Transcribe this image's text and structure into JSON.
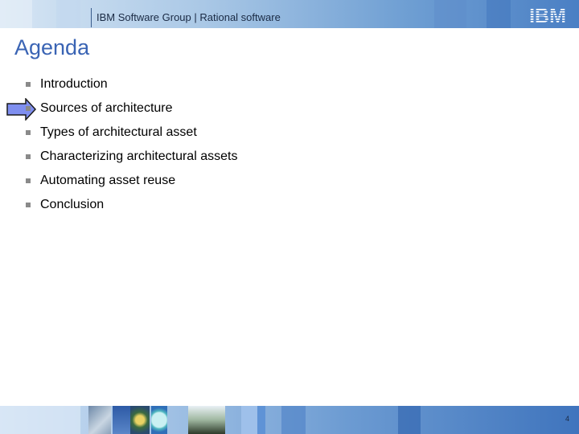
{
  "header": {
    "text": "IBM Software Group | Rational software",
    "logo": "IBM"
  },
  "slide": {
    "title": "Agenda",
    "current_item_index": 1,
    "items": [
      "Introduction",
      "Sources of architecture",
      "Types of architectural asset",
      "Characterizing architectural assets",
      "Automating asset reuse",
      "Conclusion"
    ]
  },
  "footer": {
    "page_number": "4"
  },
  "colors": {
    "title": "#3a64b4",
    "arrow_fill": "#7f8ff0",
    "bullet": "#8a8a8a",
    "header_dark": "#4a7fc4",
    "header_light": "#d7e6f4"
  },
  "icons": [
    "current-item-arrow-icon",
    "ibm-logo-icon"
  ]
}
